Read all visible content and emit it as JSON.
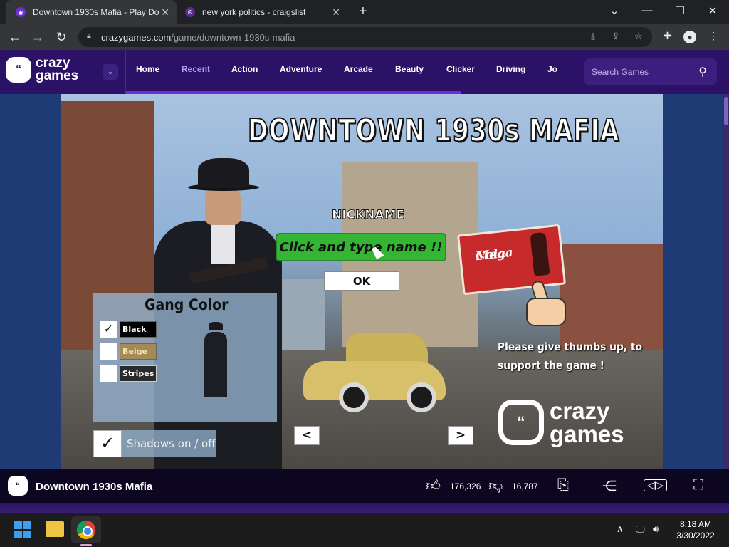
{
  "browser": {
    "tabs": [
      {
        "title": "Downtown 1930s Mafia - Play Do",
        "favicon": "crazygames-icon",
        "active": true
      },
      {
        "title": "new york politics - craigslist",
        "favicon": "craigslist-icon",
        "active": false
      }
    ],
    "new_tab": "+",
    "url_host": "crazygames.com",
    "url_path": "/game/downtown-1930s-mafia",
    "window_controls": {
      "minimize": "—",
      "restore": "❐",
      "close": "✕",
      "tab_search": "⌄"
    }
  },
  "site": {
    "logo_text_1": "crazy",
    "logo_text_2": "games",
    "nav": [
      "Home",
      "Recent",
      "Action",
      "Adventure",
      "Arcade",
      "Beauty",
      "Clicker",
      "Driving",
      "Jo"
    ],
    "selected_nav": "Recent",
    "search_placeholder": "Search Games"
  },
  "game": {
    "title": "DOWNTOWN 1930s MAFIA",
    "nickname_label": "NICKNAME",
    "name_input_placeholder": "Click and type name !!",
    "ok_label": "OK",
    "gang_color_title": "Gang Color",
    "gang_options": [
      {
        "label": "Black",
        "checked": true,
        "color": "#000000"
      },
      {
        "label": "Beige",
        "checked": false,
        "color": "#a58a55"
      },
      {
        "label": "Stripes",
        "checked": false,
        "color": "#2b2b2b"
      }
    ],
    "shadows_label": "Shadows on / off",
    "shadows_checked": true,
    "prev_label": "<",
    "next_label": ">",
    "sign_text_1": "Mega",
    "sign_text_2": "Cola",
    "thumbs_message": "Please give thumbs up, to support the game !",
    "brand_1": "crazy",
    "brand_2": "games"
  },
  "gamebar": {
    "name": "Downtown 1930s Mafia",
    "likes": "176,326",
    "dislikes": "16,787"
  },
  "taskbar": {
    "time": "8:18 AM",
    "date": "3/30/2022"
  }
}
